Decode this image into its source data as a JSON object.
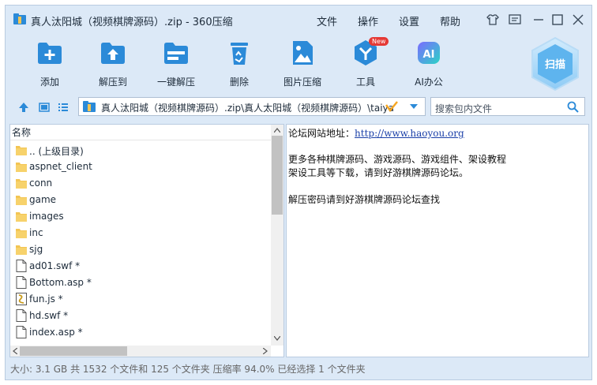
{
  "window": {
    "title": "真人汰阳城（视频棋牌源码）.zip - 360压缩"
  },
  "menu": [
    "文件",
    "操作",
    "设置",
    "帮助"
  ],
  "toolbar": {
    "add": "添加",
    "extract_to": "解压到",
    "one_click_extract": "一键解压",
    "delete": "删除",
    "image_compress": "图片压缩",
    "tools": "工具",
    "tools_badge": "New",
    "ai_office": "AI办公",
    "ai_icon_text": "AI",
    "scan": "扫描"
  },
  "address": {
    "path": "真人汰阳城（视频棋牌源码）.zip\\真人太阳城（视频棋牌源码）\\taiya",
    "search_placeholder": "搜索包内文件"
  },
  "file_list": {
    "column_name": "名称",
    "items": [
      {
        "name": ".. (上级目录)",
        "icon": "folder-icon"
      },
      {
        "name": "aspnet_client",
        "icon": "folder-icon"
      },
      {
        "name": "conn",
        "icon": "folder-icon"
      },
      {
        "name": "game",
        "icon": "folder-icon"
      },
      {
        "name": "images",
        "icon": "folder-icon"
      },
      {
        "name": "inc",
        "icon": "folder-icon"
      },
      {
        "name": "sjg",
        "icon": "folder-icon"
      },
      {
        "name": "ad01.swf *",
        "icon": "file-icon"
      },
      {
        "name": "Bottom.asp *",
        "icon": "file-icon"
      },
      {
        "name": "fun.js *",
        "icon": "js-file-icon"
      },
      {
        "name": "hd.swf *",
        "icon": "file-icon"
      },
      {
        "name": "index.asp *",
        "icon": "file-icon"
      }
    ]
  },
  "comment": {
    "line1_label": "论坛网站地址：",
    "line1_link": "http://www.haoyou.org",
    "line2": "更多各种棋牌源码、游戏源码、游戏组件、架设教程",
    "line3": "架设工具等下载，请到好游棋牌源码论坛。",
    "line4": "解压密码请到好游棋牌源码论坛查找"
  },
  "status": "大小: 3.1 GB 共 1532 个文件和 125 个文件夹 压缩率 94.0% 已经选择 1 个文件夹",
  "colors": {
    "accent": "#2b8ad8",
    "window_bg": "#dce9f7",
    "folder": "#f3c553",
    "badge": "#e53935"
  }
}
